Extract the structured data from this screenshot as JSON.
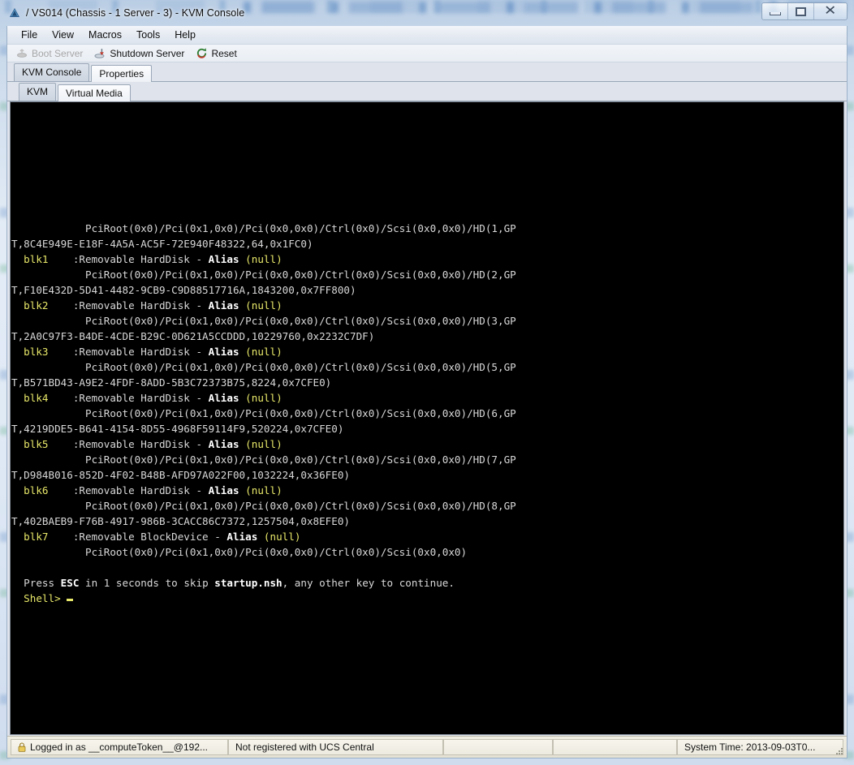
{
  "window": {
    "title": "/ VS014 (Chassis - 1 Server - 3) - KVM Console",
    "app_icon": "cisco-triangle-icon",
    "controls": {
      "minimize": "minimize-button",
      "maximize": "maximize-button",
      "close": "close-button"
    }
  },
  "menubar": {
    "items": [
      {
        "label": "File"
      },
      {
        "label": "View"
      },
      {
        "label": "Macros"
      },
      {
        "label": "Tools"
      },
      {
        "label": "Help"
      }
    ]
  },
  "toolbar": {
    "boot_server": "Boot Server",
    "boot_server_disabled": true,
    "shutdown_server": "Shutdown Server",
    "reset": "Reset"
  },
  "tabs_outer": [
    {
      "label": "KVM Console",
      "active": true
    },
    {
      "label": "Properties",
      "active": false
    }
  ],
  "tabs_inner": [
    {
      "label": "KVM",
      "active": true
    },
    {
      "label": "Virtual Media",
      "active": false
    }
  ],
  "console": {
    "colors": {
      "background": "#000000",
      "normal": "#d8d8d8",
      "yellow": "#e8e86a",
      "bright_white": "#ffffff"
    },
    "cursor": "block-cursor",
    "lines": [
      [
        {
          "t": "            PciRoot(0x0)/Pci(0x1,0x0)/Pci(0x0,0x0)/Ctrl(0x0)/Scsi(0x0,0x0)/HD(1,GP",
          "c": "w"
        }
      ],
      [
        {
          "t": "T,8C4E949E-E18F-4A5A-AC5F-72E940F48322,64,0x1FC0)",
          "c": "w"
        }
      ],
      [
        {
          "t": "  blk1",
          "c": "y"
        },
        {
          "t": "    :Removable HardDisk - ",
          "c": "w"
        },
        {
          "t": "Alias",
          "c": "bw"
        },
        {
          "t": " ",
          "c": "w"
        },
        {
          "t": "(null)",
          "c": "y"
        }
      ],
      [
        {
          "t": "            PciRoot(0x0)/Pci(0x1,0x0)/Pci(0x0,0x0)/Ctrl(0x0)/Scsi(0x0,0x0)/HD(2,GP",
          "c": "w"
        }
      ],
      [
        {
          "t": "T,F10E432D-5D41-4482-9CB9-C9D88517716A,1843200,0x7FF800)",
          "c": "w"
        }
      ],
      [
        {
          "t": "  blk2",
          "c": "y"
        },
        {
          "t": "    :Removable HardDisk - ",
          "c": "w"
        },
        {
          "t": "Alias",
          "c": "bw"
        },
        {
          "t": " ",
          "c": "w"
        },
        {
          "t": "(null)",
          "c": "y"
        }
      ],
      [
        {
          "t": "            PciRoot(0x0)/Pci(0x1,0x0)/Pci(0x0,0x0)/Ctrl(0x0)/Scsi(0x0,0x0)/HD(3,GP",
          "c": "w"
        }
      ],
      [
        {
          "t": "T,2A0C97F3-B4DE-4CDE-B29C-0D621A5CCDDD,10229760,0x2232C7DF)",
          "c": "w"
        }
      ],
      [
        {
          "t": "  blk3",
          "c": "y"
        },
        {
          "t": "    :Removable HardDisk - ",
          "c": "w"
        },
        {
          "t": "Alias",
          "c": "bw"
        },
        {
          "t": " ",
          "c": "w"
        },
        {
          "t": "(null)",
          "c": "y"
        }
      ],
      [
        {
          "t": "            PciRoot(0x0)/Pci(0x1,0x0)/Pci(0x0,0x0)/Ctrl(0x0)/Scsi(0x0,0x0)/HD(5,GP",
          "c": "w"
        }
      ],
      [
        {
          "t": "T,B571BD43-A9E2-4FDF-8ADD-5B3C72373B75,8224,0x7CFE0)",
          "c": "w"
        }
      ],
      [
        {
          "t": "  blk4",
          "c": "y"
        },
        {
          "t": "    :Removable HardDisk - ",
          "c": "w"
        },
        {
          "t": "Alias",
          "c": "bw"
        },
        {
          "t": " ",
          "c": "w"
        },
        {
          "t": "(null)",
          "c": "y"
        }
      ],
      [
        {
          "t": "            PciRoot(0x0)/Pci(0x1,0x0)/Pci(0x0,0x0)/Ctrl(0x0)/Scsi(0x0,0x0)/HD(6,GP",
          "c": "w"
        }
      ],
      [
        {
          "t": "T,4219DDE5-B641-4154-8D55-4968F59114F9,520224,0x7CFE0)",
          "c": "w"
        }
      ],
      [
        {
          "t": "  blk5",
          "c": "y"
        },
        {
          "t": "    :Removable HardDisk - ",
          "c": "w"
        },
        {
          "t": "Alias",
          "c": "bw"
        },
        {
          "t": " ",
          "c": "w"
        },
        {
          "t": "(null)",
          "c": "y"
        }
      ],
      [
        {
          "t": "            PciRoot(0x0)/Pci(0x1,0x0)/Pci(0x0,0x0)/Ctrl(0x0)/Scsi(0x0,0x0)/HD(7,GP",
          "c": "w"
        }
      ],
      [
        {
          "t": "T,D984B016-852D-4F02-B48B-AFD97A022F00,1032224,0x36FE0)",
          "c": "w"
        }
      ],
      [
        {
          "t": "  blk6",
          "c": "y"
        },
        {
          "t": "    :Removable HardDisk - ",
          "c": "w"
        },
        {
          "t": "Alias",
          "c": "bw"
        },
        {
          "t": " ",
          "c": "w"
        },
        {
          "t": "(null)",
          "c": "y"
        }
      ],
      [
        {
          "t": "            PciRoot(0x0)/Pci(0x1,0x0)/Pci(0x0,0x0)/Ctrl(0x0)/Scsi(0x0,0x0)/HD(8,GP",
          "c": "w"
        }
      ],
      [
        {
          "t": "T,402BAEB9-F76B-4917-986B-3CACC86C7372,1257504,0x8EFE0)",
          "c": "w"
        }
      ],
      [
        {
          "t": "  blk7",
          "c": "y"
        },
        {
          "t": "    :Removable BlockDevice - ",
          "c": "w"
        },
        {
          "t": "Alias",
          "c": "bw"
        },
        {
          "t": " ",
          "c": "w"
        },
        {
          "t": "(null)",
          "c": "y"
        }
      ],
      [
        {
          "t": "            PciRoot(0x0)/Pci(0x1,0x0)/Pci(0x0,0x0)/Ctrl(0x0)/Scsi(0x0,0x0)",
          "c": "w"
        }
      ],
      [
        {
          "t": "",
          "c": "w"
        }
      ],
      [
        {
          "t": "  Press ",
          "c": "w"
        },
        {
          "t": "ESC",
          "c": "bw"
        },
        {
          "t": " in 1 seconds to skip ",
          "c": "w"
        },
        {
          "t": "startup.nsh",
          "c": "bw"
        },
        {
          "t": ", any other key to continue.",
          "c": "w"
        }
      ],
      [
        {
          "t": "  Shell> ",
          "c": "y"
        },
        {
          "t": "█",
          "c": "cursor"
        }
      ]
    ]
  },
  "statusbar": {
    "logged_in": "Logged in as __computeToken__@192...",
    "lock_icon": "lock-icon",
    "ucs_central": "Not registered with UCS Central",
    "empty_1": "",
    "empty_2": "",
    "system_time": "System Time: 2013-09-03T0...",
    "resize_grip": "resize-grip"
  }
}
